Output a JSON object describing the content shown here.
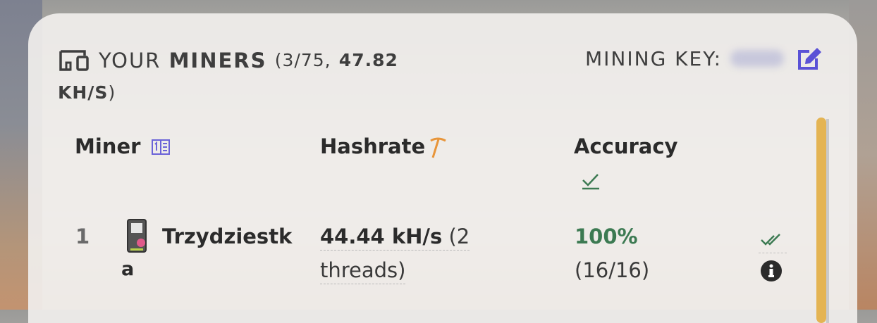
{
  "header": {
    "prefix": "YOUR",
    "title_bold": "MINERS",
    "count_text": "(3/75,",
    "hashrate_value": "47.82",
    "hashrate_unit": "KH/S",
    "paren_close": ")"
  },
  "mining_key": {
    "label": "MINING KEY:"
  },
  "columns": {
    "miner": "Miner",
    "hashrate": "Hashrate",
    "accuracy": "Accuracy"
  },
  "icons": {
    "header": "devices-icon",
    "edit": "edit-icon",
    "miner_col": "calculator-icon",
    "hashrate_col": "pickaxe-icon",
    "accuracy_col": "check-icon",
    "row_device": "device-icon",
    "row_status": "double-check-icon",
    "row_info": "info-icon"
  },
  "colors": {
    "accent_purple": "#5a52d6",
    "pickaxe_orange": "#e8953a",
    "accuracy_green": "#3c7a52",
    "scrollbar": "#e4b453"
  },
  "rows": [
    {
      "index": "1",
      "name_line1": "Trzydziestk",
      "name_line2": "a",
      "hashrate": "44.44 kH/s",
      "threads_line1": "(2",
      "threads_line2": "threads)",
      "accuracy": "100%",
      "shares": "(16/16)"
    }
  ]
}
